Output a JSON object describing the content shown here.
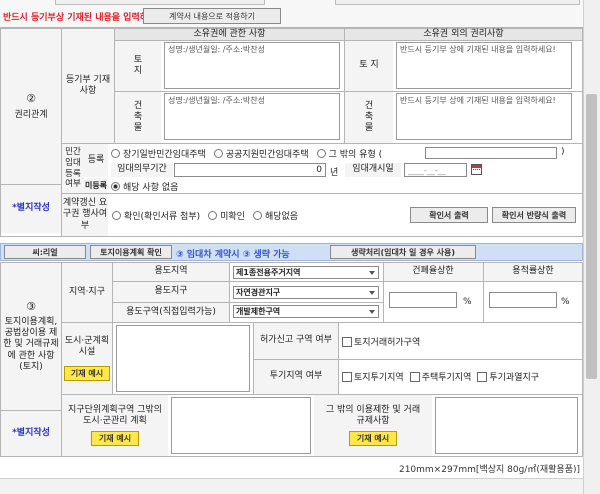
{
  "top_notice": {
    "warning": "반드시 등기부상 기재된 내용을 입력하세요!",
    "apply_button": "계약서 내용으로 적용하기"
  },
  "rights_section": {
    "number": "②",
    "title": "권리관계",
    "registry_label": "등기부 기재사항",
    "col_owner": "소유권에 관한 사항",
    "col_other": "소유권 외의 권리사항",
    "land_label": "토 지",
    "building_label": "건 축 물",
    "owner_land_text": "성명:/생년월일: /주소:박찬성",
    "owner_building_text": "성명:/생년월일: /주소:박찬성",
    "other_land_text": "반드시 등기부 상에 기재된 내용을 입력하세요!",
    "other_building_text": "반드시 등기부 상에 기재된 내용을 입력하세요!",
    "attach_label": "*별지작성",
    "private_rental_label": "민간 임대 등록 여부",
    "registered_label": "등록",
    "unregistered_label": "미등록",
    "rental_types": [
      "장기일반민간임대주택",
      "공공지원민간임대주택",
      "그 밖의 유형 ("
    ],
    "type_close": ")",
    "obligation_period_label": "임대의무기간",
    "obligation_value": "0",
    "obligation_unit": "년",
    "start_date_label": "임대개시일",
    "date_placeholder": "____-__-__",
    "none_option": "해당 사항 없음",
    "renewal_label": "계약갱신 요구권 행사여부",
    "renewal_options": [
      "확인(확인서류 첨부)",
      "미확인",
      "해당없음"
    ],
    "confirm_print": "확인서 출력",
    "refusal_print": "확인서 반량식 출력"
  },
  "land_use_bar": {
    "ri_button": "씨:리얼",
    "plan_button": "토지이용계획 확인",
    "notice": "③ 임대차 계약시 ③ 생략 가능",
    "omit_button": "생략처리(임대차 일 경우 사용)"
  },
  "land_use_section": {
    "number": "③",
    "title": "토지이용계획, 공법상이용 제한 및 거래규제에 관한 사항 (토지)",
    "region_label": "지역·지구",
    "use_area_label": "용도지역",
    "use_area_value": "제1종전용주거지역",
    "use_district_label": "용도지구",
    "use_district_value": "자연경관지구",
    "use_zone_label": "용도구역(직접입력가능)",
    "use_zone_value": "개발제한구역",
    "coverage_label": "건폐율상한",
    "far_label": "용적률상한",
    "percent": "%",
    "urban_plan_label": "도시·군계획 시설",
    "example_button": "기재 예시",
    "permit_label": "허가신고 구역 여부",
    "permit_option": "토지거래허가구역",
    "speculation_label": "투기지역 여부",
    "speculation_options": [
      "토지투기지역",
      "주택투기지역",
      "투기과열지구"
    ],
    "district_plan_label": "지구단위계획구역 그밖의 도시·군관리 계획",
    "other_restriction_label": "그 밖의 이용제한 및 거래규제사항",
    "attach_label": "*별지작성"
  },
  "footer": {
    "paper": "210mm×297mm[백상지 80g/㎡(재활용품)]"
  },
  "colors": {
    "warning_red": "#e0202a",
    "attach_blue": "#2633c8",
    "notice_blue": "#3a54c8",
    "bar_bg": "#cfe0f6",
    "example_yellow": "#ffe84a"
  }
}
